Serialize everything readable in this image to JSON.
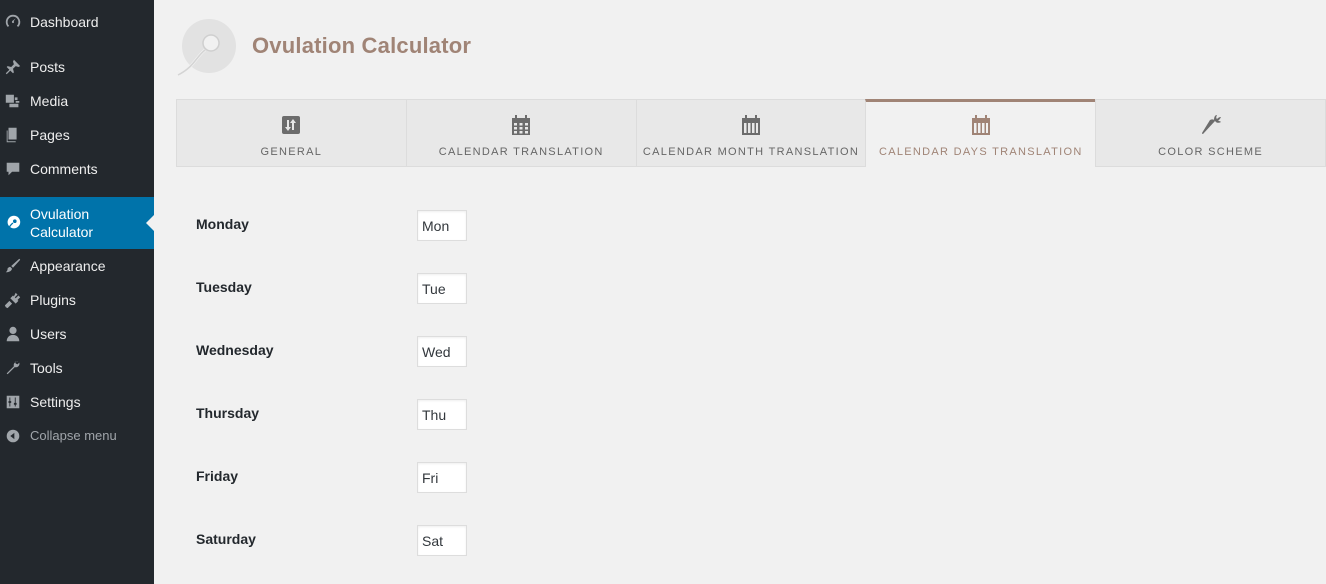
{
  "sidebar": {
    "items": [
      {
        "label": "Dashboard",
        "icon": "dashboard-icon"
      },
      {
        "label": "Posts",
        "icon": "pin-icon"
      },
      {
        "label": "Media",
        "icon": "media-icon"
      },
      {
        "label": "Pages",
        "icon": "pages-icon"
      },
      {
        "label": "Comments",
        "icon": "comment-icon"
      },
      {
        "label": "Ovulation Calculator",
        "icon": "ovulation-icon",
        "active": true
      },
      {
        "label": "Appearance",
        "icon": "brush-icon"
      },
      {
        "label": "Plugins",
        "icon": "plug-icon"
      },
      {
        "label": "Users",
        "icon": "user-icon"
      },
      {
        "label": "Tools",
        "icon": "wrench-icon"
      },
      {
        "label": "Settings",
        "icon": "sliders-icon"
      }
    ],
    "collapse_label": "Collapse menu"
  },
  "header": {
    "title": "Ovulation Calculator"
  },
  "tabs": [
    {
      "label": "GENERAL",
      "icon": "sort-icon"
    },
    {
      "label": "CALENDAR TRANSLATION",
      "icon": "calendar-icon"
    },
    {
      "label": "CALENDAR MONTH TRANSLATION",
      "icon": "calendar-bars-icon"
    },
    {
      "label": "CALENDAR DAYS TRANSLATION",
      "icon": "calendar-bars-icon",
      "active": true
    },
    {
      "label": "COLOR SCHEME",
      "icon": "carrot-icon"
    }
  ],
  "form": {
    "rows": [
      {
        "label": "Monday",
        "value": "Mon"
      },
      {
        "label": "Tuesday",
        "value": "Tue"
      },
      {
        "label": "Wednesday",
        "value": "Wed"
      },
      {
        "label": "Thursday",
        "value": "Thu"
      },
      {
        "label": "Friday",
        "value": "Fri"
      },
      {
        "label": "Saturday",
        "value": "Sat"
      }
    ]
  },
  "colors": {
    "sidebar_bg": "#23282d",
    "active_nav": "#0073aa",
    "brand": "#a08476",
    "page_bg": "#f1f1f1"
  }
}
